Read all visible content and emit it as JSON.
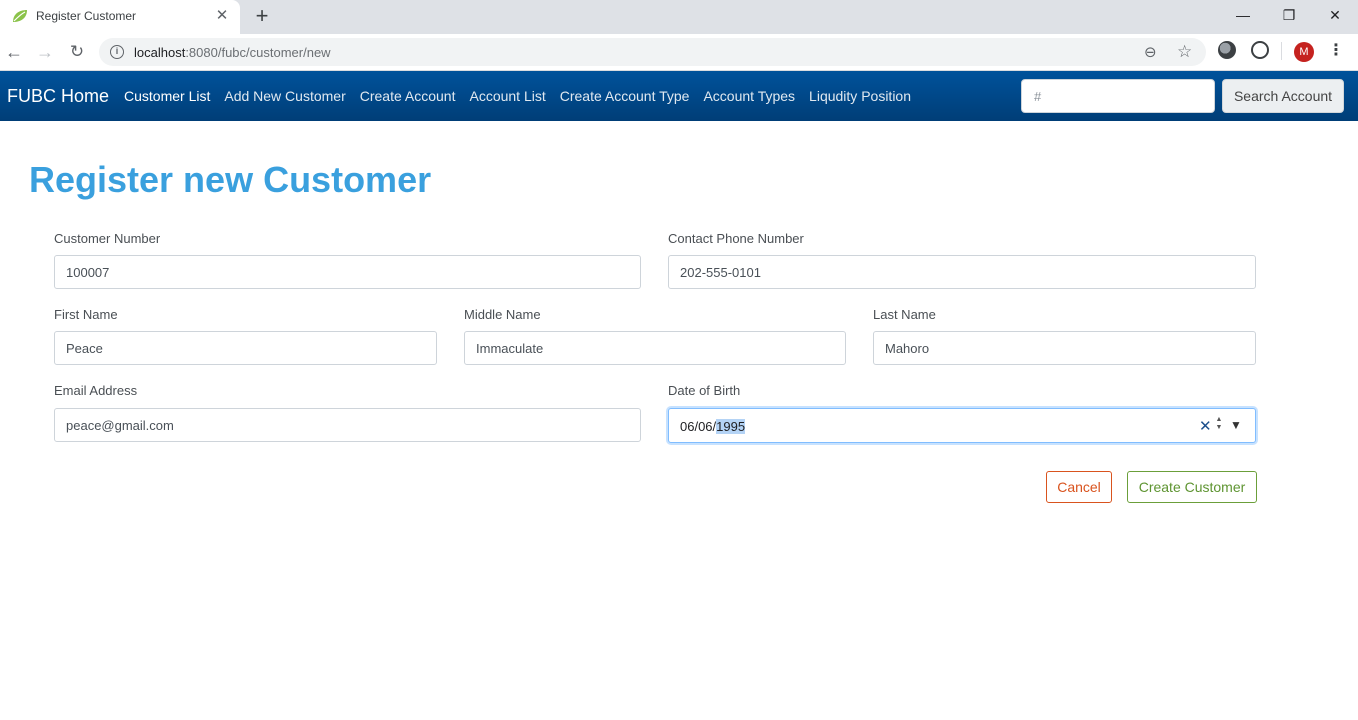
{
  "browser": {
    "tab_title": "Register Customer",
    "favicon": "spring-leaf-icon",
    "url_host": "localhost",
    "url_path": ":8080/fubc/customer/new",
    "profile_initial": "M",
    "colors": {
      "profile": "#c5221f"
    }
  },
  "navbar": {
    "brand": "FUBC Home",
    "links": [
      "Customer List",
      "Add New Customer",
      "Create Account",
      "Account List",
      "Create Account Type",
      "Account Types",
      "Liqudity Position"
    ],
    "search_placeholder": "#",
    "search_button": "Search Account",
    "colors": {
      "background": "#00529b"
    }
  },
  "page": {
    "title": "Register new Customer",
    "colors": {
      "title": "#3aa0de"
    }
  },
  "form": {
    "customer_number": {
      "label": "Customer Number",
      "value": "100007"
    },
    "contact_phone": {
      "label": "Contact Phone Number",
      "value": "202-555-0101"
    },
    "first_name": {
      "label": "First Name",
      "value": "Peace"
    },
    "middle_name": {
      "label": "Middle Name",
      "value": "Immaculate"
    },
    "last_name": {
      "label": "Last Name",
      "value": "Mahoro"
    },
    "email": {
      "label": "Email Address",
      "value": "peace@gmail.com"
    },
    "date_of_birth": {
      "label": "Date of Birth",
      "value_prefix": "06/06/",
      "value_selected": "1995"
    }
  },
  "actions": {
    "cancel": "Cancel",
    "create": "Create Customer",
    "colors": {
      "cancel": "#d9531e",
      "create": "#5e9431"
    }
  }
}
